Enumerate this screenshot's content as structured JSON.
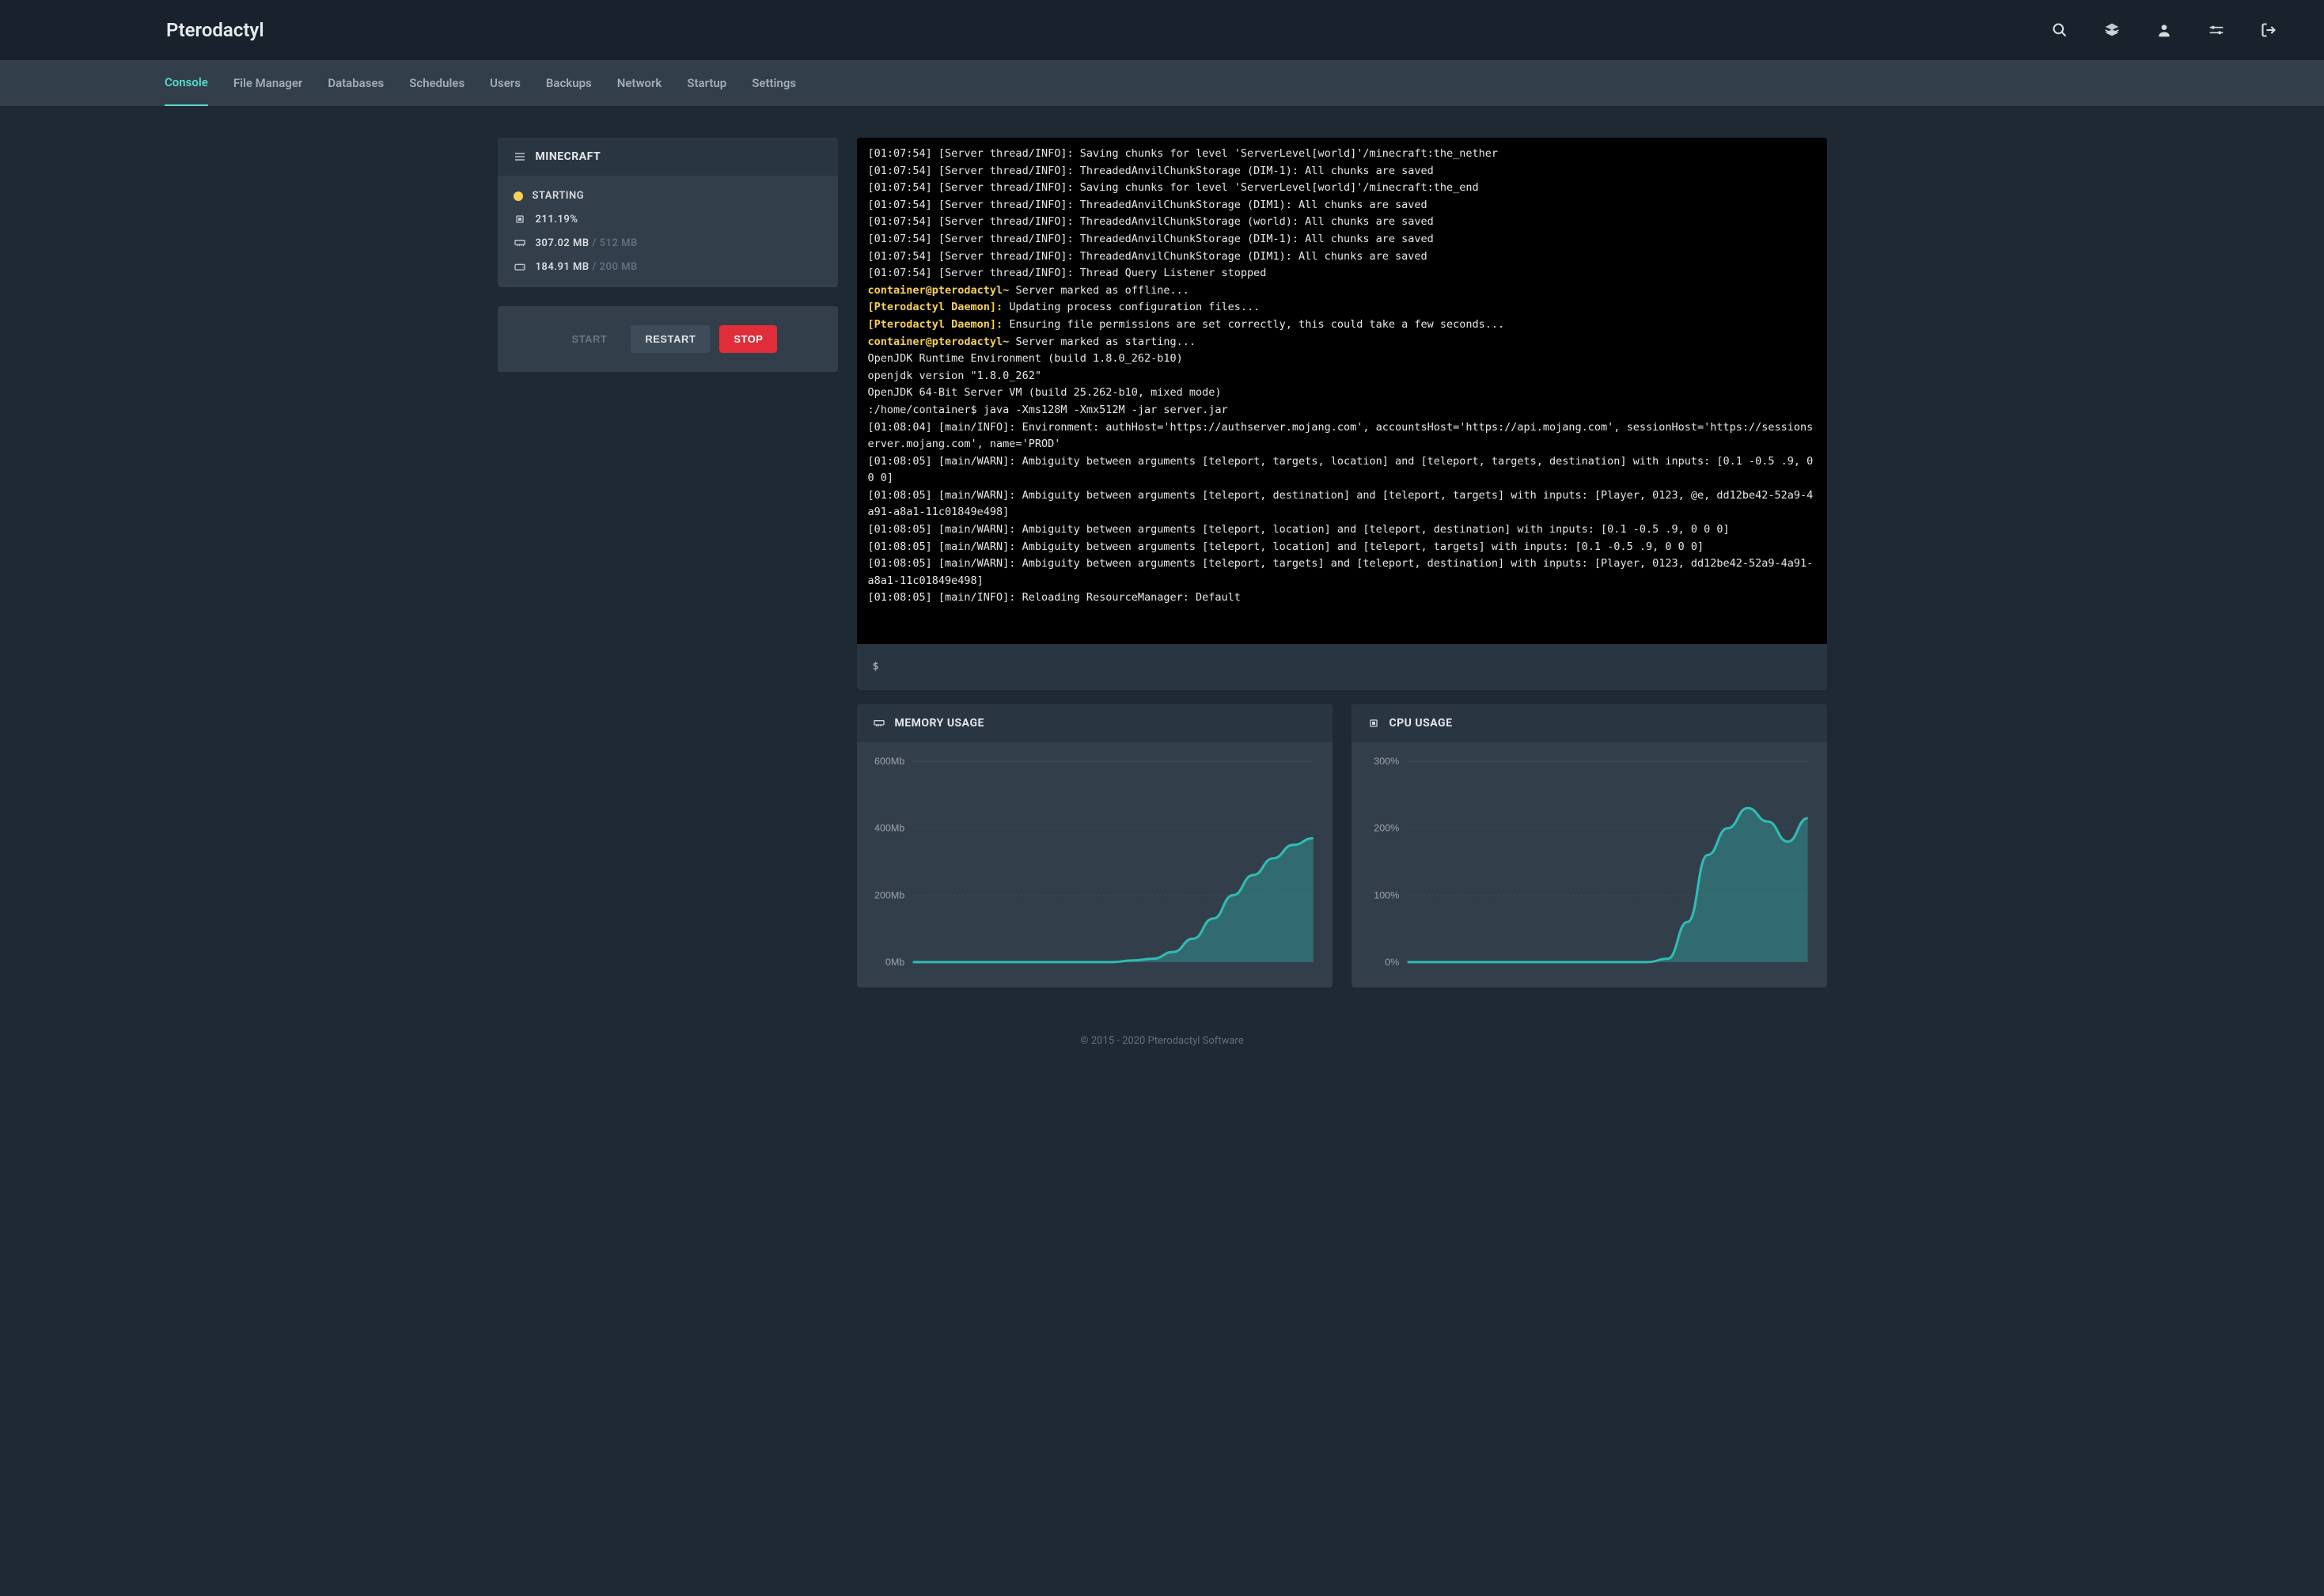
{
  "brand": "Pterodactyl",
  "top_icons": [
    "search",
    "layers",
    "user",
    "settings",
    "logout"
  ],
  "tabs": [
    "Console",
    "File Manager",
    "Databases",
    "Schedules",
    "Users",
    "Backups",
    "Network",
    "Startup",
    "Settings"
  ],
  "active_tab": 0,
  "server_panel": {
    "title": "MINECRAFT",
    "status_label": "STARTING",
    "status_color": "#f7d154",
    "cpu_percent": "211.19%",
    "memory_used": "307.02 MB",
    "memory_limit": "512 MB",
    "disk_used": "184.91 MB",
    "disk_limit": "200 MB"
  },
  "power_buttons": {
    "start": "START",
    "restart": "RESTART",
    "stop": "STOP"
  },
  "console_lines": [
    {
      "text": "[01:07:54] [Server thread/INFO]: Saving chunks for level 'ServerLevel[world]'/minecraft:the_nether"
    },
    {
      "text": "[01:07:54] [Server thread/INFO]: ThreadedAnvilChunkStorage (DIM-1): All chunks are saved"
    },
    {
      "text": "[01:07:54] [Server thread/INFO]: Saving chunks for level 'ServerLevel[world]'/minecraft:the_end"
    },
    {
      "text": "[01:07:54] [Server thread/INFO]: ThreadedAnvilChunkStorage (DIM1): All chunks are saved"
    },
    {
      "text": "[01:07:54] [Server thread/INFO]: ThreadedAnvilChunkStorage (world): All chunks are saved"
    },
    {
      "text": "[01:07:54] [Server thread/INFO]: ThreadedAnvilChunkStorage (DIM-1): All chunks are saved"
    },
    {
      "text": "[01:07:54] [Server thread/INFO]: ThreadedAnvilChunkStorage (DIM1): All chunks are saved"
    },
    {
      "text": "[01:07:54] [Server thread/INFO]: Thread Query Listener stopped"
    },
    {
      "prompt": "container@pterodactyl~",
      "text": " Server marked as offline..."
    },
    {
      "daemon": "[Pterodactyl Daemon]:",
      "text": " Updating process configuration files..."
    },
    {
      "daemon": "[Pterodactyl Daemon]:",
      "text": " Ensuring file permissions are set correctly, this could take a few seconds..."
    },
    {
      "prompt": "container@pterodactyl~",
      "text": " Server marked as starting..."
    },
    {
      "text": "OpenJDK Runtime Environment (build 1.8.0_262-b10)"
    },
    {
      "text": "openjdk version \"1.8.0_262\""
    },
    {
      "text": "OpenJDK 64-Bit Server VM (build 25.262-b10, mixed mode)"
    },
    {
      "text": ":/home/container$ java -Xms128M -Xmx512M -jar server.jar"
    },
    {
      "text": "[01:08:04] [main/INFO]: Environment: authHost='https://authserver.mojang.com', accountsHost='https://api.mojang.com', sessionHost='https://sessionserver.mojang.com', name='PROD'"
    },
    {
      "text": "[01:08:05] [main/WARN]: Ambiguity between arguments [teleport, targets, location] and [teleport, targets, destination] with inputs: [0.1 -0.5 .9, 0 0 0]"
    },
    {
      "text": "[01:08:05] [main/WARN]: Ambiguity between arguments [teleport, destination] and [teleport, targets] with inputs: [Player, 0123, @e, dd12be42-52a9-4a91-a8a1-11c01849e498]"
    },
    {
      "text": "[01:08:05] [main/WARN]: Ambiguity between arguments [teleport, location] and [teleport, destination] with inputs: [0.1 -0.5 .9, 0 0 0]"
    },
    {
      "text": "[01:08:05] [main/WARN]: Ambiguity between arguments [teleport, location] and [teleport, targets] with inputs: [0.1 -0.5 .9, 0 0 0]"
    },
    {
      "text": "[01:08:05] [main/WARN]: Ambiguity between arguments [teleport, targets] and [teleport, destination] with inputs: [Player, 0123, dd12be42-52a9-4a91-a8a1-11c01849e498]"
    },
    {
      "text": "[01:08:05] [main/INFO]: Reloading ResourceManager: Default"
    }
  ],
  "console_prompt": "$",
  "memory_panel_title": "MEMORY USAGE",
  "cpu_panel_title": "CPU USAGE",
  "footer": "© 2015 - 2020 Pterodactyl Software",
  "chart_data": [
    {
      "type": "area",
      "title": "MEMORY USAGE",
      "ylabel": "Mb",
      "ylim": [
        0,
        600
      ],
      "yticks": [
        0,
        200,
        400,
        600
      ],
      "ytick_labels": [
        "0Mb",
        "200Mb",
        "400Mb",
        "600Mb"
      ],
      "x": [
        0,
        1,
        2,
        3,
        4,
        5,
        6,
        7,
        8,
        9,
        10,
        11,
        12,
        13,
        14,
        15,
        16,
        17,
        18,
        19,
        20
      ],
      "values": [
        0,
        0,
        0,
        0,
        0,
        0,
        0,
        0,
        0,
        0,
        0,
        5,
        10,
        30,
        70,
        130,
        200,
        260,
        310,
        350,
        370
      ]
    },
    {
      "type": "area",
      "title": "CPU USAGE",
      "ylabel": "%",
      "ylim": [
        0,
        300
      ],
      "yticks": [
        0,
        100,
        200,
        300
      ],
      "ytick_labels": [
        "0%",
        "100%",
        "200%",
        "300%"
      ],
      "x": [
        0,
        1,
        2,
        3,
        4,
        5,
        6,
        7,
        8,
        9,
        10,
        11,
        12,
        13,
        14,
        15,
        16,
        17,
        18,
        19,
        20
      ],
      "values": [
        0,
        0,
        0,
        0,
        0,
        0,
        0,
        0,
        0,
        0,
        0,
        0,
        0,
        5,
        60,
        160,
        200,
        230,
        210,
        180,
        215
      ]
    }
  ]
}
